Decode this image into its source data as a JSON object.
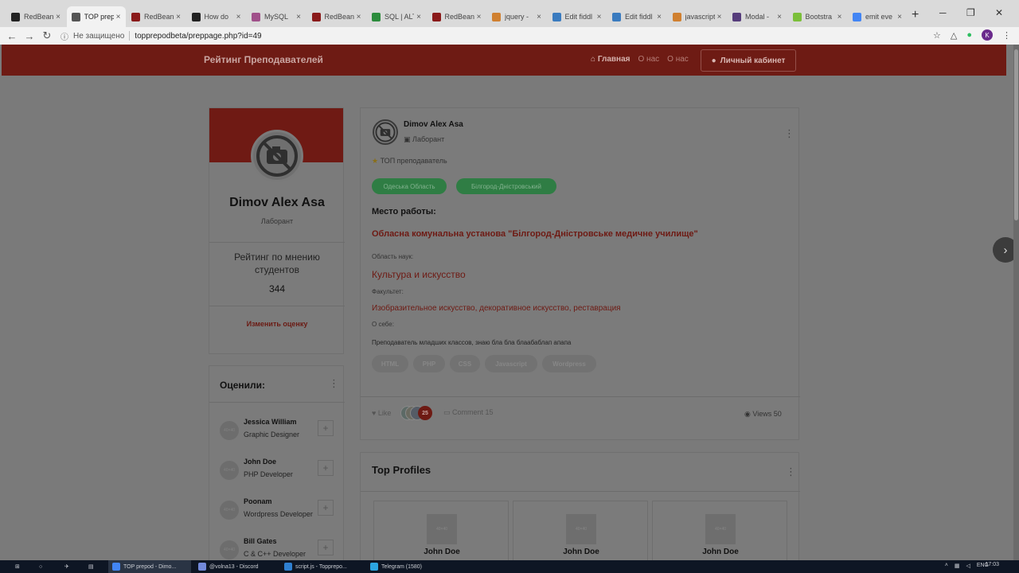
{
  "browser": {
    "tabs": [
      {
        "label": "RedBean",
        "color": "#222222"
      },
      {
        "label": "TOP prep",
        "color": "#555555",
        "active": true
      },
      {
        "label": "RedBean",
        "color": "#8a1a1a"
      },
      {
        "label": "How do",
        "color": "#222222"
      },
      {
        "label": "MySQL",
        "color": "#a0508a"
      },
      {
        "label": "RedBean",
        "color": "#8a1a1a"
      },
      {
        "label": "SQL | ALT",
        "color": "#2c8c3c"
      },
      {
        "label": "RedBean",
        "color": "#8a1a1a"
      },
      {
        "label": "jquery -",
        "color": "#d08030"
      },
      {
        "label": "Edit fiddl",
        "color": "#3a7bbf"
      },
      {
        "label": "Edit fiddl",
        "color": "#3a7bbf"
      },
      {
        "label": "javascript",
        "color": "#d08030"
      },
      {
        "label": "Modal -",
        "color": "#563d7c"
      },
      {
        "label": "Bootstra",
        "color": "#7bbf3a"
      },
      {
        "label": "emit eve",
        "color": "#4285f4"
      }
    ],
    "new_tab": "+",
    "security_text": "Не защищено",
    "url": "topprepodbeta/preppage.php?id=49",
    "profile_letter": "K"
  },
  "site": {
    "brand": "Рейтинг Преподавателей",
    "nav": {
      "home": "Главная",
      "about1": "О нас",
      "about2": "О нас",
      "cabinet": "Личный кабинет"
    }
  },
  "profile": {
    "name": "Dimov Alex Asa",
    "role": "Лаборант",
    "rating_title": "Рейтинг по мнению студентов",
    "rating_value": "344",
    "change_rating": "Изменить оценку"
  },
  "raters": {
    "title": "Оценили:",
    "items": [
      {
        "name": "Jessica William",
        "job": "Graphic Designer",
        "avatar": "40×40"
      },
      {
        "name": "John Doe",
        "job": "PHP Developer",
        "avatar": "40×40"
      },
      {
        "name": "Poonam",
        "job": "Wordpress Developer",
        "avatar": "40×40"
      },
      {
        "name": "Bill Gates",
        "job": "C & C++ Developer",
        "avatar": "40×40"
      }
    ]
  },
  "post": {
    "name": "Dimov Alex Asa",
    "role": "Лаборант",
    "top_badge": "ТОП преподаватель",
    "regions": [
      "Одеська Область",
      "Білгород-Дністровський"
    ],
    "work_label": "Место работы:",
    "work": "Обласна комунальна установа \"Білгород-Дністровське медичне училище\"",
    "field_label": "Область наук:",
    "field": "Культура и искусство",
    "faculty_label": "Факультет:",
    "faculty": "Изобразительное искусство, декоративное искусство, реставрация",
    "about_label": "О себе:",
    "about": "Преподаватель младших классов, знаю бла бла блаабаблап апапа",
    "tags": [
      "HTML",
      "PHP",
      "CSS",
      "Javascript",
      "Wordpress"
    ],
    "like": "Like",
    "likes_count": "25",
    "comments": "Comment 15",
    "views": "Views 50"
  },
  "top_profiles": {
    "title": "Top Profiles",
    "items": [
      {
        "name": "John Doe",
        "image": "40×40"
      },
      {
        "name": "John Doe",
        "image": "40×40"
      },
      {
        "name": "John Doe",
        "image": "40×40"
      }
    ]
  },
  "taskbar": {
    "items": [
      {
        "label": "TOP prepod - Dimo...",
        "color": "#4285f4",
        "active": true
      },
      {
        "label": "@volna13 - Discord",
        "color": "#7289da"
      },
      {
        "label": "script.js - Topprepo...",
        "color": "#2f80d1"
      },
      {
        "label": "Telegram (1580)",
        "color": "#2ca5e0"
      }
    ],
    "lang": "ENG",
    "time": "17:03"
  }
}
